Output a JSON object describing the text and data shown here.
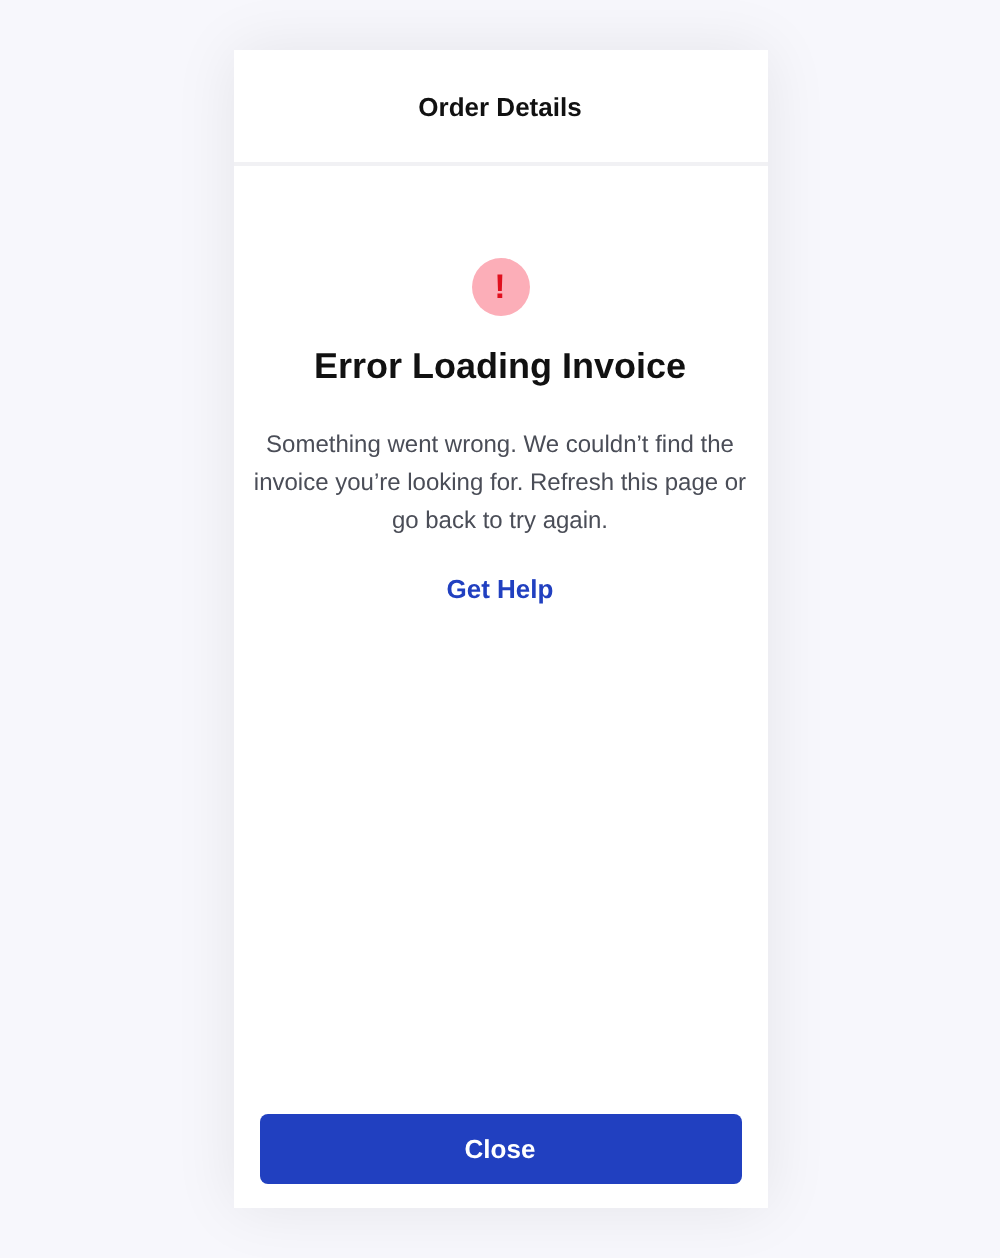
{
  "header": {
    "title": "Order Details"
  },
  "error": {
    "icon": "!",
    "title": "Error Loading Invoice",
    "message": "Something went wrong. We couldn’t find the invoice you’re looking for. Refresh this page or go back to try again.",
    "link": "Get Help"
  },
  "footer": {
    "button": "Close"
  }
}
